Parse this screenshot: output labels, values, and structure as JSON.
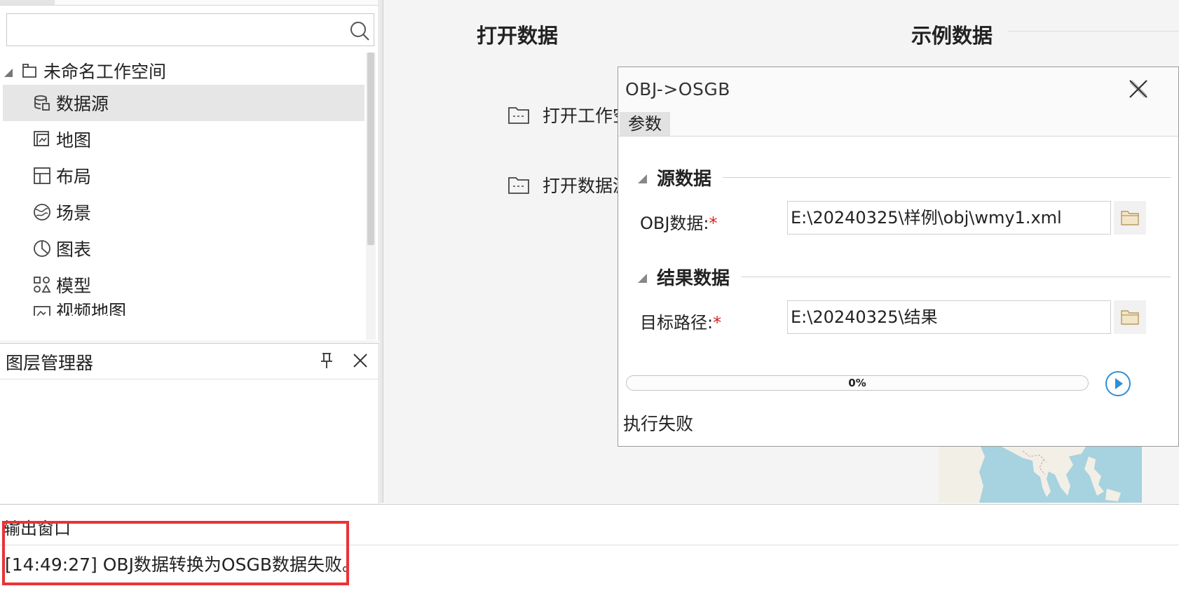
{
  "workspace": {
    "search": {
      "value": "",
      "placeholder": ""
    },
    "root_label": "未命名工作空间",
    "items": [
      {
        "label": "数据源",
        "icon": "datasource-icon",
        "selected": true
      },
      {
        "label": "地图",
        "icon": "map-icon",
        "selected": false
      },
      {
        "label": "布局",
        "icon": "layout-icon",
        "selected": false
      },
      {
        "label": "场景",
        "icon": "scene-icon",
        "selected": false
      },
      {
        "label": "图表",
        "icon": "chart-icon",
        "selected": false
      },
      {
        "label": "模型",
        "icon": "model-icon",
        "selected": false
      },
      {
        "label": "视频地图",
        "icon": "video-map-icon",
        "selected": false
      }
    ]
  },
  "layer_manager": {
    "title": "图层管理器"
  },
  "start_page": {
    "open_heading": "打开数据",
    "sample_heading": "示例数据",
    "open_items": [
      {
        "label": "打开工作空间"
      },
      {
        "label": "打开数据源"
      }
    ]
  },
  "dialog": {
    "title": "OBJ->OSGB",
    "tab": "参数",
    "source_section": "源数据",
    "obj_label": "OBJ数据:",
    "obj_value": "E:\\20240325\\样例\\obj\\wmy1.xml",
    "result_section": "结果数据",
    "target_label": "目标路径:",
    "target_value": "E:\\20240325\\结果",
    "required_mark": "*",
    "progress_percent": 0,
    "progress_text": "0%",
    "status": "执行失败"
  },
  "output": {
    "title": "输出窗口",
    "message": "[14:49:27] OBJ数据转换为OSGB数据失败。"
  },
  "colors": {
    "required": "#e0201b",
    "highlight_box": "#ea3237",
    "run_button": "#2d8fd6",
    "folder": "#c9b48c"
  }
}
